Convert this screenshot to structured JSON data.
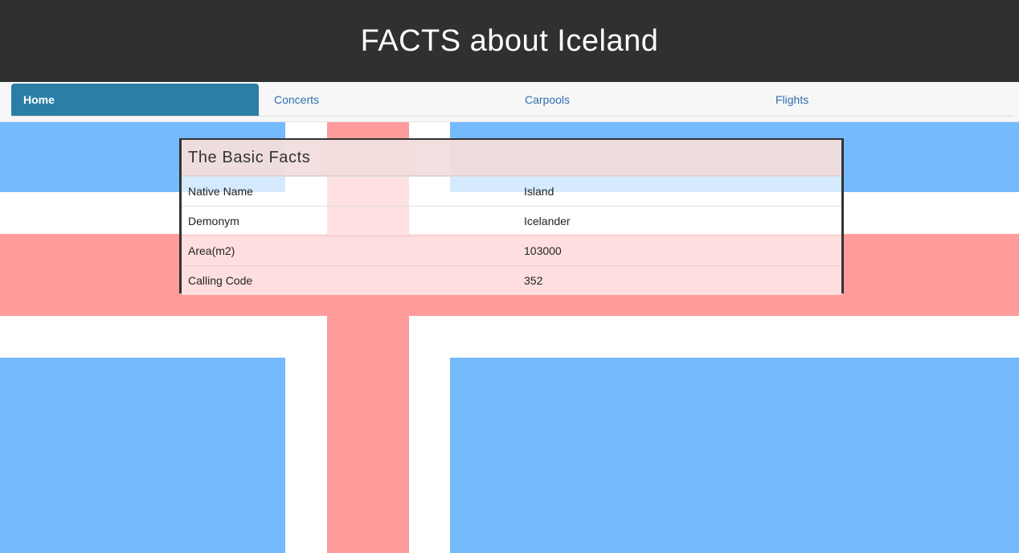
{
  "header": {
    "title": "FACTS about Iceland"
  },
  "nav": {
    "tabs": [
      {
        "label": "Home",
        "active": true
      },
      {
        "label": "Concerts",
        "active": false
      },
      {
        "label": "Carpools",
        "active": false
      },
      {
        "label": "Flights",
        "active": false
      }
    ]
  },
  "colors": {
    "header_bg": "#303030",
    "active_tab": "#2b7ea5",
    "link": "#2f6fb0",
    "flag_blue": "#74bafd",
    "flag_red": "#fe9b9b",
    "flag_white": "#ffffff",
    "panel_heading": "#f2dede"
  },
  "panel": {
    "title": "The Basic Facts",
    "rows": [
      {
        "label": "Native Name",
        "value": "Island"
      },
      {
        "label": "Demonym",
        "value": "Icelander"
      },
      {
        "label": "Area(m2)",
        "value": "103000"
      },
      {
        "label": "Calling Code",
        "value": "352"
      }
    ]
  }
}
